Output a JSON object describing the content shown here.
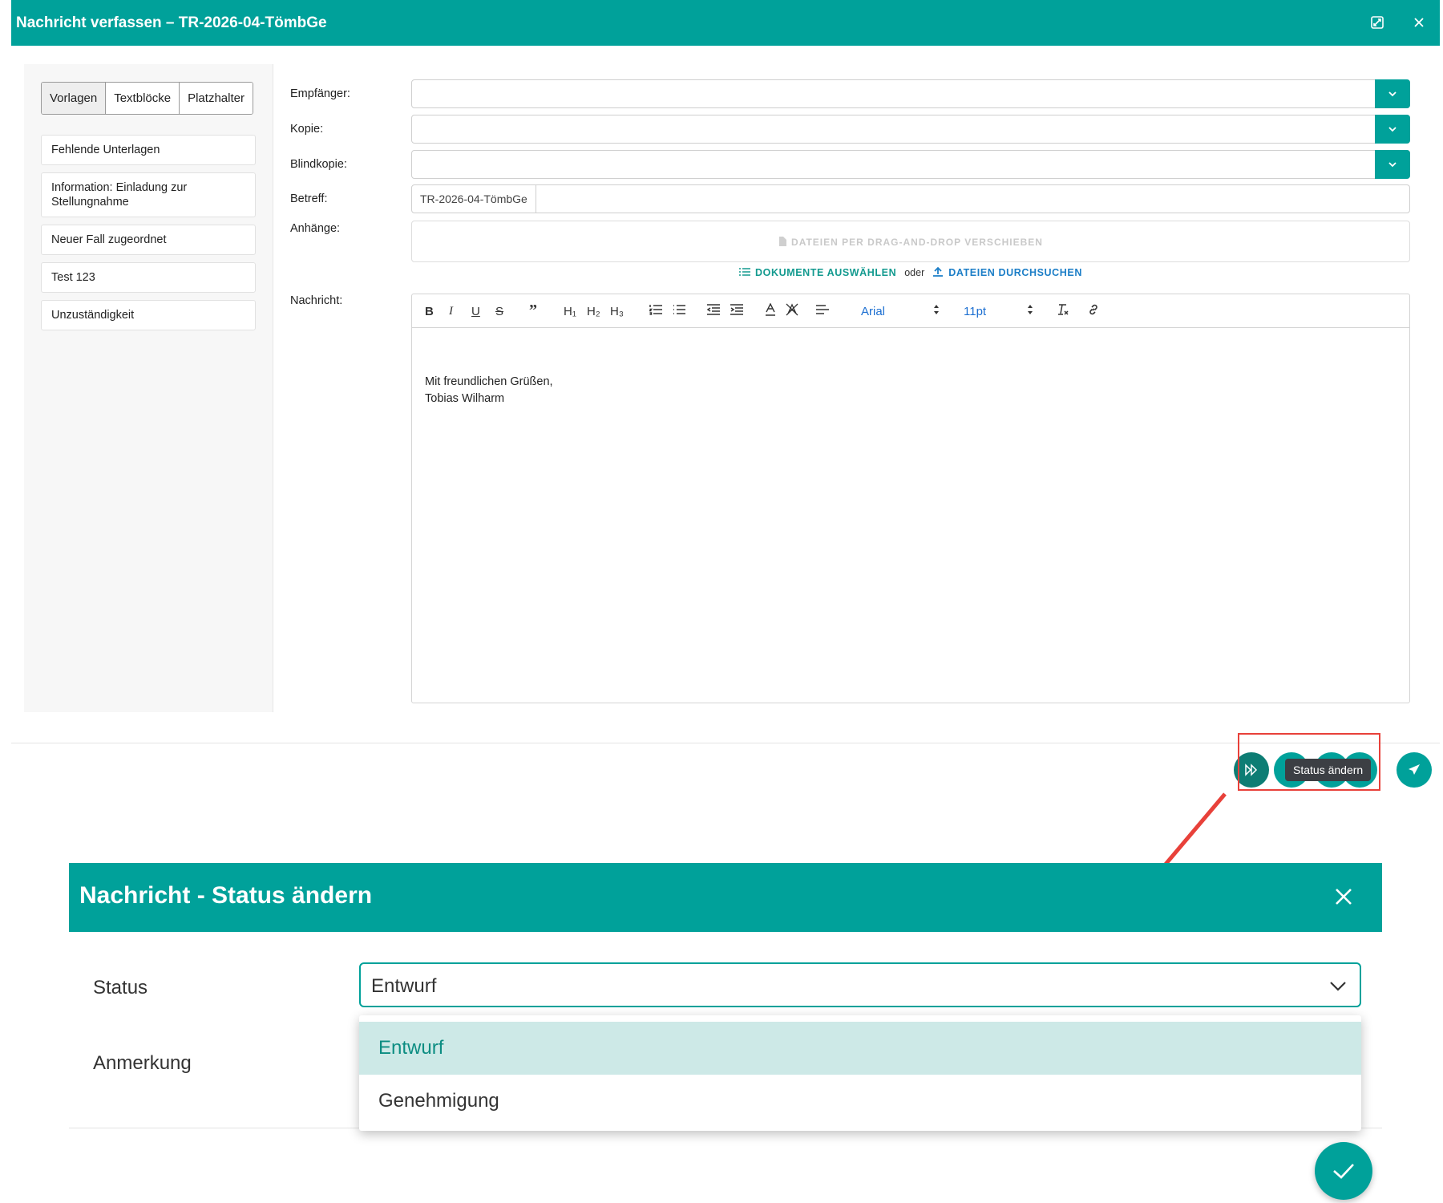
{
  "composer": {
    "title": "Nachricht verfassen – TR-2026-04-TömbGe",
    "tabs": [
      "Vorlagen",
      "Textblöcke",
      "Platzhalter"
    ],
    "templates": [
      "Fehlende Unterlagen",
      "Information: Einladung zur Stellungnahme",
      "Neuer Fall zugeordnet",
      "Test 123",
      "Unzuständigkeit"
    ],
    "labels": {
      "recipient": "Empfänger:",
      "cc": "Kopie:",
      "bcc": "Blindkopie:",
      "subject": "Betreff:",
      "attachments": "Anhänge:",
      "message": "Nachricht:"
    },
    "subject_prefix": "TR-2026-04-TömbGe",
    "dropzone_text": "DATEIEN PER DRAG-AND-DROP VERSCHIEBEN",
    "select_documents": "DOKUMENTE AUSWÄHLEN",
    "or": "oder",
    "browse_files": "DATEIEN DURCHSUCHEN",
    "editor": {
      "font": "Arial",
      "size": "11pt",
      "body_line1": "Mit freundlichen Grüßen,",
      "body_line2": "Tobias Wilharm"
    },
    "tooltip": "Status ändern"
  },
  "dialog": {
    "title": "Nachricht - Status ändern",
    "status_label": "Status",
    "note_label": "Anmerkung",
    "selected": "Entwurf",
    "options": [
      "Entwurf",
      "Genehmigung"
    ]
  },
  "colors": {
    "brand": "#00a19a",
    "highlight": "#e8413a",
    "link": "#1c7ec7"
  }
}
